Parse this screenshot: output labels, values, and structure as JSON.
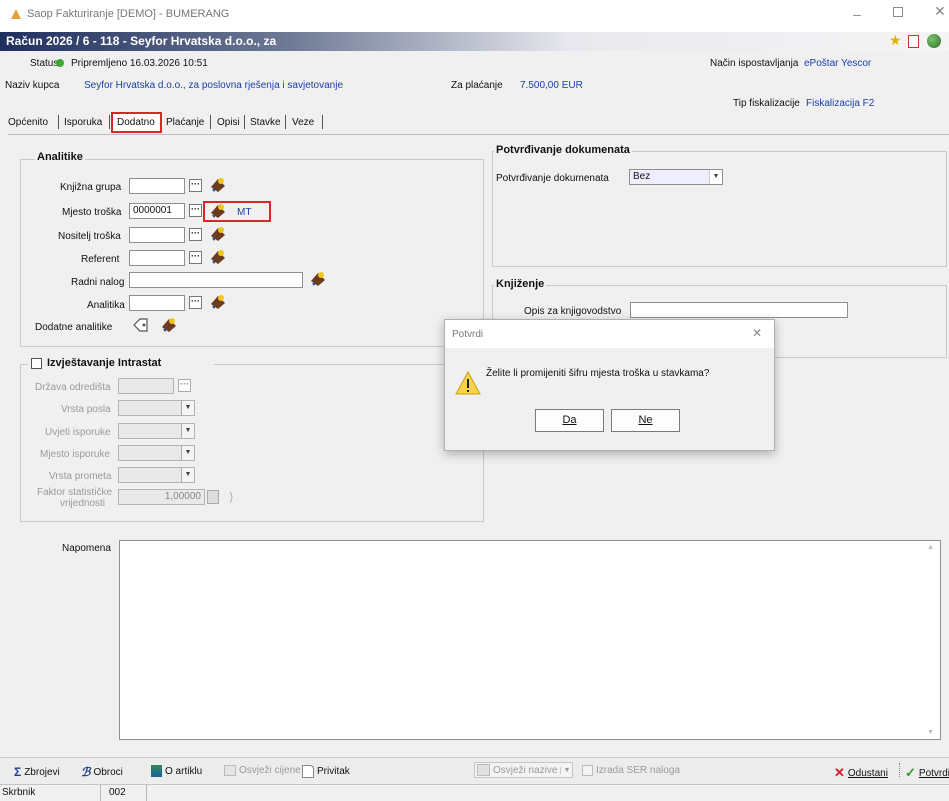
{
  "app": {
    "window_title": "Saop Fakturiranje [DEMO] - BUMERANG",
    "doc_title": "Račun  2026 / 6 - 118 - Seyfor Hrvatska d.o.o., za"
  },
  "header": {
    "status_label": "Status",
    "status_value": "Pripremljeno 16.03.2026 10:51",
    "status_color": "#3fa535",
    "delivery_label": "Način ispostavljanja",
    "delivery_value": "ePoštar Yescor",
    "buyer_label": "Naziv kupca",
    "buyer_value": "Seyfor Hrvatska d.o.o., za  poslovna rješenja i savjetovanje",
    "payment_label": "Za plaćanje",
    "payment_value": "7.500,00 EUR",
    "fiscal_label": "Tip fiskalizacije",
    "fiscal_value": "Fiskalizacija F2"
  },
  "tabs": [
    {
      "label": "Općenito"
    },
    {
      "label": "Isporuka"
    },
    {
      "label": "Dodatno",
      "active": true
    },
    {
      "label": "Plaćanje"
    },
    {
      "label": "Opisi"
    },
    {
      "label": "Stavke"
    },
    {
      "label": "Veze"
    }
  ],
  "analitike": {
    "title": "Analitike",
    "knjizna_grupa_label": "Knjižna grupa",
    "knjizna_grupa_value": "",
    "mjesto_troska_label": "Mjesto troška",
    "mjesto_troska_value": "0000001",
    "mjesto_troska_code": "MT",
    "nositelj_label": "Nositelj troška",
    "referent_label": "Referent",
    "radni_nalog_label": "Radni nalog",
    "analitika_label": "Analitika",
    "dodatne_label": "Dodatne analitike"
  },
  "intrastat": {
    "title": "Izvještavanje Intrastat",
    "drzava_label": "Država odredišta",
    "vrsta_posla_label": "Vrsta posla",
    "uvjeti_label": "Uvjeti isporuke",
    "mjesto_isporuke_label": "Mjesto isporuke",
    "vrsta_prometa_label": "Vrsta prometa",
    "faktor_label_1": "Faktor statističke",
    "faktor_label_2": "vrijednosti",
    "faktor_value": "1,00000"
  },
  "potvrdivanje": {
    "title": "Potvrđivanje dokumenata",
    "label": "Potvrđivanje dokumenata",
    "value": "Bez"
  },
  "knjizenje": {
    "title": "Knjiženje",
    "opis_label": "Opis za knjigovodstvo",
    "opis_value": ""
  },
  "napomena": {
    "label": "Napomena",
    "value": ""
  },
  "dialog": {
    "title": "Potvrdi",
    "message": "Želite li promijeniti šifru mjesta troška u stavkama?",
    "yes_label": "Da",
    "no_label": "Ne"
  },
  "toolbar": {
    "zbrojevi": "Zbrojevi",
    "obroci": "Obroci",
    "o_artiklu": "O artiklu",
    "osvjezi_cijene": "Osvježi cijene",
    "privitak": "Privitak",
    "osvjezi_nazive": "Osvježi nazive",
    "izrada_ser": "Izrada SER naloga",
    "odustani": "Odustani",
    "potvrdi": "Potvrdi"
  },
  "statusbar": {
    "label": "Skrbnik",
    "value": "002"
  },
  "colors": {
    "title_bar_from": "#1f2f5e",
    "title_bar_to": "#8a93ad",
    "link_blue": "#1a3fa8",
    "highlight_red": "#d9262b"
  }
}
